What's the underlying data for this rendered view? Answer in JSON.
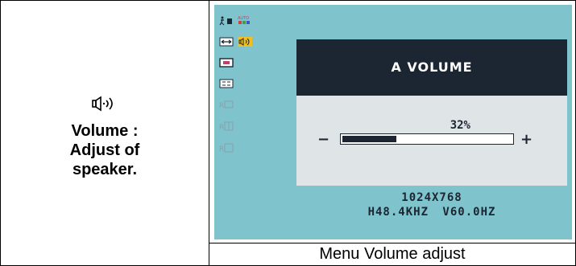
{
  "left_panel": {
    "icon": "speaker-volume-icon",
    "line1": "Volume :",
    "line2": "Adjust of",
    "line3": "speaker."
  },
  "caption": "Menu Volume adjust",
  "osd": {
    "nav_icons": [
      "person-tv-icon",
      "auto-color-icon",
      "input-arrows-icon",
      "speaker-volume-icon",
      "screen-icon",
      "size-icon",
      "reset-icon-1",
      "reset-icon-2",
      "reset-icon-3"
    ],
    "title": "A VOLUME",
    "volume_percent": "32%",
    "volume_fraction": 0.32,
    "minus_label": "−",
    "plus_label": "+",
    "resolution": "1024X768",
    "frequency": "H48.4KHZ V60.0HZ",
    "colors": {
      "background": "#7fc4cd",
      "header": "#1c2632",
      "panel": "#dfe4e6",
      "highlight": "#f0c020"
    }
  }
}
